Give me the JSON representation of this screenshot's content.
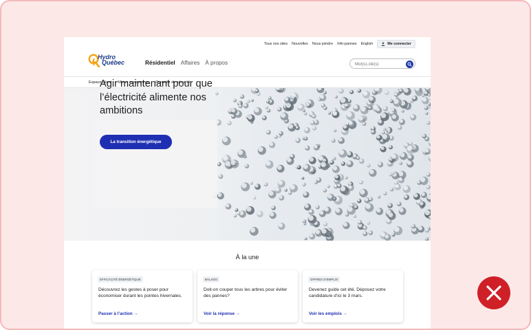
{
  "utility": {
    "links": [
      "Tous nos sites",
      "Nouvelles",
      "Nous joindre",
      "Info-pannes",
      "English"
    ],
    "login_label": "Me connecter"
  },
  "logo": {
    "line1": "Hydro",
    "line2": "Québec"
  },
  "nav": {
    "items": [
      "Résidentiel",
      "Affaires",
      "À propos"
    ]
  },
  "search": {
    "placeholder": "Mot(s)-clé(s)"
  },
  "subnav": {
    "items": [
      "Espace client",
      "Mieux consommer",
      "Conseils de sécurité"
    ]
  },
  "hero": {
    "title": "Agir maintenant pour que l’électricité alimente nos ambitions",
    "button_label": "La transition énergétique"
  },
  "featured": {
    "title": "À la une",
    "cards": [
      {
        "tag": "EFFICACITÉ ÉNERGÉTIQUE",
        "text": "Découvrez les gestes à poser pour économiser durant les pointes hivernales.",
        "link": "Passer à l’action"
      },
      {
        "tag": "BALADO",
        "text": "Doit-on couper tous les arbres pour éviter des pannes?",
        "link": "Voir la réponse"
      },
      {
        "tag": "OFFRES D’EMPLOI",
        "text": "Devenez guide cet été. Déposez votre candidature d’ici le 3 mars.",
        "link": "Voir les emplois"
      }
    ]
  },
  "colors": {
    "brand_blue": "#1f2fb3",
    "logo_orange": "#f2a81d",
    "frame_pink": "#fde8e8",
    "error_red": "#cf2027"
  }
}
